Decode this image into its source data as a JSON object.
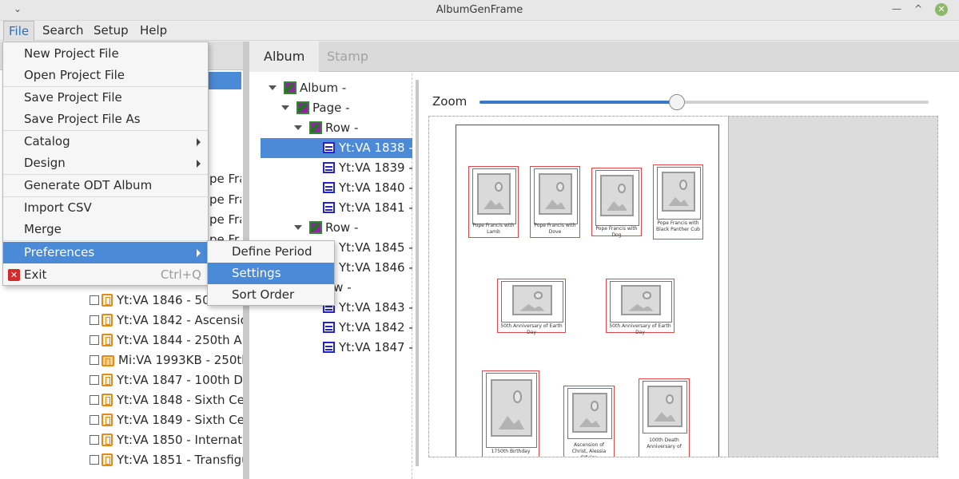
{
  "window": {
    "title": "AlbumGenFrame",
    "collapse_glyph": "⌄",
    "minimize_glyph": "—",
    "maximize_glyph": "^",
    "close_glyph": "✕"
  },
  "menubar": [
    "File",
    "Search",
    "Setup",
    "Help"
  ],
  "file_menu": {
    "items": [
      {
        "label": "New Project File"
      },
      {
        "label": "Open Project File"
      },
      {
        "label": "Save Project File"
      },
      {
        "label": "Save Project File As"
      },
      {
        "label": "Catalog"
      },
      {
        "label": "Design"
      },
      {
        "label": "Generate ODT Album"
      },
      {
        "label": "Import CSV"
      },
      {
        "label": "Merge"
      },
      {
        "label": "Preferences"
      },
      {
        "label": "Exit",
        "shortcut": "Ctrl+Q",
        "icon": "x"
      }
    ]
  },
  "preferences_submenu": [
    "Define Period",
    "Settings",
    "Sort Order"
  ],
  "left_list": {
    "peek_texts": [
      "pe Fra",
      "pe Fra",
      "pe Fra",
      "pe Fr"
    ],
    "rows": [
      "Yt:VA 1846 - 50",
      "Yt:VA 1842 - Ascensio",
      "Yt:VA 1844 - 250th An",
      "Mi:VA 1993KB - 250th",
      "Yt:VA 1847 - 100th De",
      "Yt:VA 1848 - Sixth Cen",
      "Yt:VA 1849 - Sixth Cen",
      "Yt:VA 1850 - Internati",
      "Yt:VA 1851 - Transfigu"
    ]
  },
  "tabs": [
    "Album",
    "Stamp"
  ],
  "tree": {
    "album": "Album -",
    "page": "Page -",
    "row1": "Row -",
    "row1_items": [
      "Yt:VA 1838 -",
      "Yt:VA 1839 -",
      "Yt:VA 1840 -",
      "Yt:VA 1841 -"
    ],
    "row2": "Row -",
    "row2_items": [
      "Yt:VA 1845 -",
      "Yt:VA 1846 -"
    ],
    "row3": "ow -",
    "row3_items": [
      "Yt:VA 1843 -",
      "Yt:VA 1842 -",
      "Yt:VA 1847 -"
    ]
  },
  "zoom": {
    "label": "Zoom",
    "value_fraction": 0.44
  },
  "stamps": {
    "row1": [
      "Pope Francis with Lamb",
      "Pope Francis with Dove",
      "Pope Francis with Dog",
      "Pope Francis with Black Panther Cub"
    ],
    "row2": [
      "50th Anniversary of Earth Day",
      "50th Anniversary of Earth Day"
    ],
    "row3": [
      "1750th Birthday",
      "Ascension of Christ, Alessia Bifulco",
      "100th Death Anniversary of"
    ]
  }
}
